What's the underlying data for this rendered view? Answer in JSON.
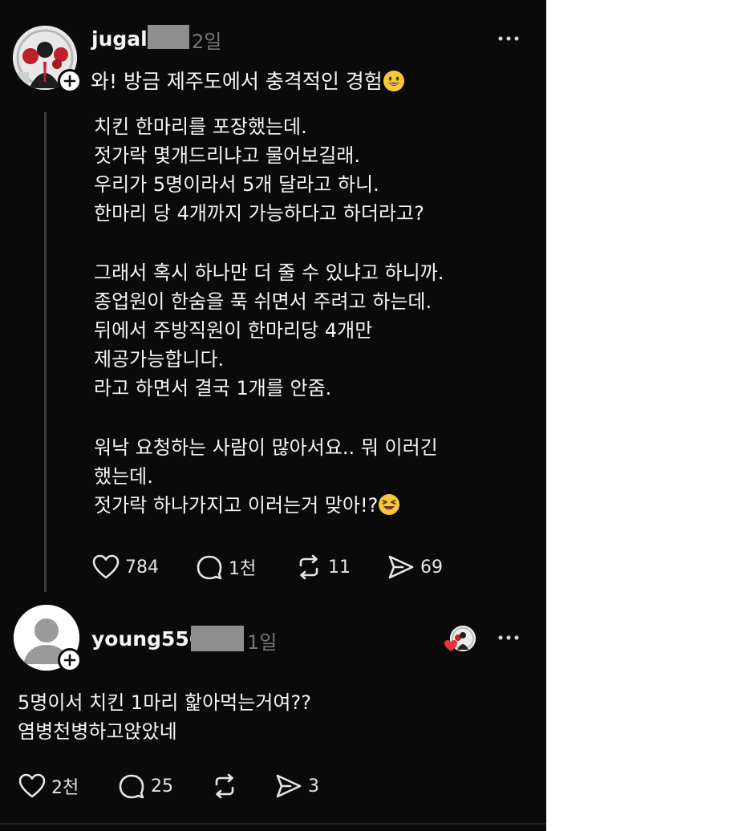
{
  "post": {
    "username": "jugal",
    "time": "2일",
    "headline": "와! 방금 제주도에서 충격적인 경험",
    "headline_emoji": "grinning-face-emoji",
    "paragraphs": [
      [
        "치킨 한마리를 포장했는데.",
        "젓가락 몇개드리냐고 물어보길래.",
        "우리가 5명이라서 5개 달라고 하니.",
        "한마리 당 4개까지 가능하다고 하더라고?"
      ],
      [
        "그래서 혹시 하나만 더 줄 수 있냐고 하니까.",
        "종업원이 한숨을 푹 쉬면서 주려고 하는데.",
        "뒤에서 주방직원이 한마리당 4개만",
        "제공가능합니다.",
        "라고 하면서 결국 1개를 안줌."
      ],
      [
        "워낙 요청하는 사람이 많아서요.. 뭐 이러긴",
        "했는데.",
        "젓가락 하나가지고 이러는거 맞아!?"
      ]
    ],
    "last_line_emoji": "laughing-face-emoji",
    "actions": {
      "likes": "784",
      "comments": "1천",
      "reposts": "11",
      "shares": "69"
    }
  },
  "reply": {
    "username": "young556",
    "time": "1일",
    "lines": [
      "5명이서 치킨 1마리 핥아먹는거여??",
      "염병천병하고앉았네"
    ],
    "actions": {
      "likes": "2천",
      "comments": "25",
      "shares": "3"
    }
  },
  "colors": {
    "background": "#0a0a0a",
    "text": "#f3f5f7",
    "muted": "#777777",
    "redaction": "#8e8e8e",
    "heart_red": "#e8343a"
  }
}
